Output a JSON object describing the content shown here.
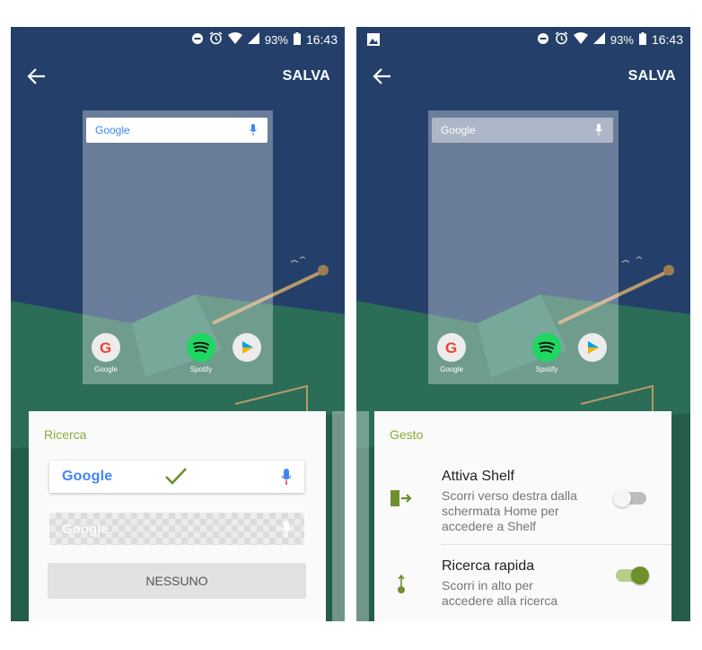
{
  "colors": {
    "accent": "#8bab3a",
    "wall_sky": "#24406a",
    "wall_ground": "#2a6a55",
    "panel": "#fafafa"
  },
  "status_bar": {
    "battery": "93%",
    "time": "16:43"
  },
  "app_bar": {
    "save_label": "SALVA"
  },
  "preview": {
    "google_logo": "Google",
    "apps": [
      {
        "label": "Google"
      },
      {
        "label": "Spotify"
      }
    ]
  },
  "left_panel": {
    "title": "Ricerca",
    "options": {
      "google": "Google",
      "transparent": "Google",
      "none": "NESSUNO"
    }
  },
  "right_panel": {
    "title": "Gesto",
    "items": [
      {
        "title": "Attiva Shelf",
        "description": "Scorri verso destra dalla schermata Home per accedere a Shelf",
        "enabled": false
      },
      {
        "title": "Ricerca rapida",
        "description": "Scorri in alto per accedere alla ricerca",
        "enabled": true
      }
    ]
  }
}
